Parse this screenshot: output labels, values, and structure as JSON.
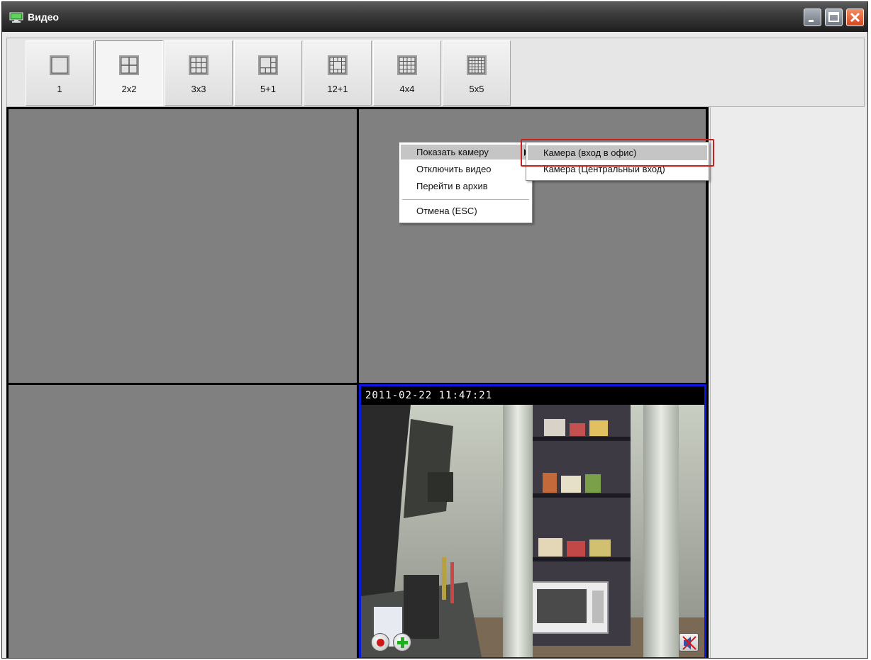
{
  "window": {
    "title": "Видео",
    "accent_colors": {
      "titlebar": "#1e1e1e",
      "active_cell_border": "#0a18e0",
      "callout": "#cc2020"
    }
  },
  "toolbar": {
    "layouts": [
      {
        "label": "1",
        "icon": "layout-1-icon"
      },
      {
        "label": "2x2",
        "icon": "layout-2x2-icon",
        "active": true
      },
      {
        "label": "3x3",
        "icon": "layout-3x3-icon"
      },
      {
        "label": "5+1",
        "icon": "layout-5plus1-icon"
      },
      {
        "label": "12+1",
        "icon": "layout-12plus1-icon"
      },
      {
        "label": "4x4",
        "icon": "layout-4x4-icon"
      },
      {
        "label": "5x5",
        "icon": "layout-5x5-icon"
      }
    ]
  },
  "video": {
    "timestamp": "2011-02-22 11:47:21"
  },
  "context_menu": {
    "items": [
      "Показать камеру",
      "Отключить видео",
      "Перейти в архив",
      "Отмена (ESC)"
    ]
  },
  "submenu": {
    "items": [
      "Камера (вход в офис)",
      "Камера (Центральный вход)"
    ]
  }
}
